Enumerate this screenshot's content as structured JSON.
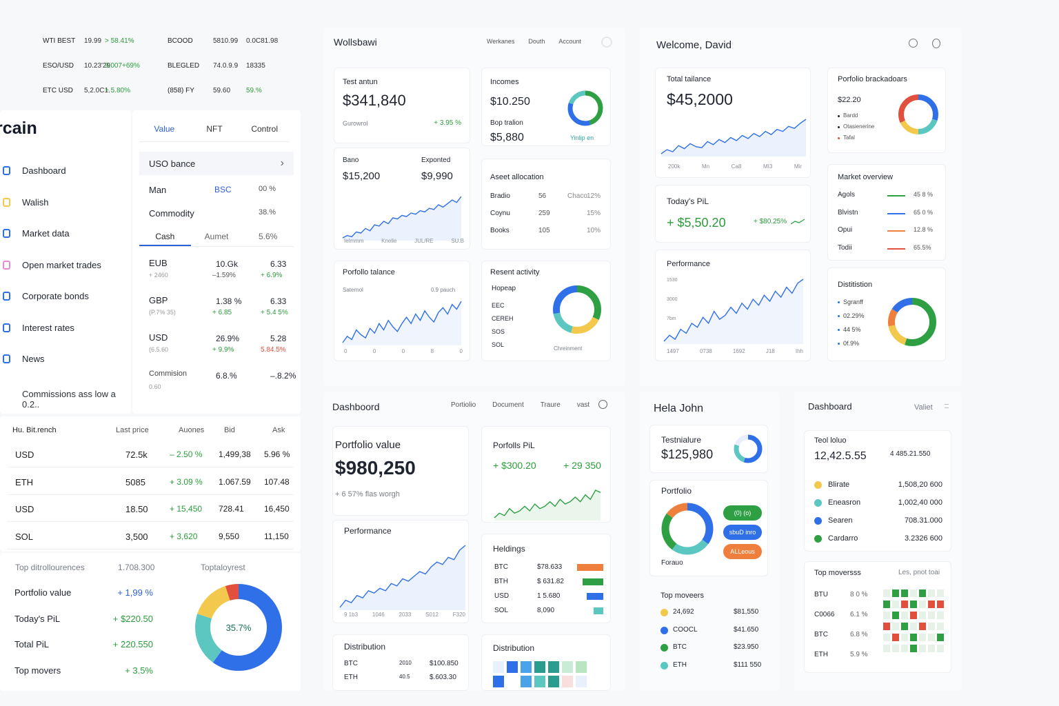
{
  "colors": {
    "blue": "#2f6fe8",
    "green": "#2ea043",
    "yellow": "#f2c94c",
    "teal": "#5cc7c1",
    "orange": "#ef7f3c",
    "red": "#e0503c",
    "light": "#e8eefc"
  },
  "ticker": [
    {
      "a": "WTI BEST",
      "b": "19.99",
      "c": "> 58.41%",
      "d": "BCOOD",
      "e": "5810.99",
      "f": "0.0C81.98"
    },
    {
      "a": "ESO/USD",
      "b": "10.23'29",
      "c": "9.007+69%",
      "d": "BLEGLED",
      "e": "74.0.9.9",
      "f": "18335"
    },
    {
      "a": "ETC USD",
      "b": "5,2.0C1.",
      "c": "+ 5.80%",
      "d": "(858) FY",
      "e": "59.60",
      "f": "59.%"
    }
  ],
  "left": {
    "brand": "rcain",
    "nav": [
      {
        "label": "Dashboard",
        "icon": "document-icon"
      },
      {
        "label": "Walish",
        "icon": "wallet-icon"
      },
      {
        "label": "Market data",
        "icon": "globe-icon"
      },
      {
        "label": "Open market trades",
        "icon": "trade-icon"
      },
      {
        "label": "Corporate bonds",
        "icon": "bar-chart-icon"
      },
      {
        "label": "Interest rates",
        "icon": "monitor-icon"
      },
      {
        "label": "News",
        "icon": "news-icon"
      }
    ],
    "commission": "Commissions ass low a 0.2..",
    "tabs": [
      "Value",
      "NFT",
      "Control"
    ],
    "uso": "USO bance",
    "alloc": [
      {
        "a": "Man",
        "b": "BSC",
        "c": "00 %"
      },
      {
        "a": "Commodity",
        "b": "",
        "c": "38.%"
      }
    ],
    "subtabs": [
      "Cash",
      "Aumet",
      "5.6%"
    ],
    "fx": [
      {
        "cur": "EUB",
        "sub": "+ 2460",
        "v": "10.Gk",
        "v2": "–1.59%",
        "c": "6.33",
        "c2": "+ 6.9%"
      },
      {
        "cur": "GBP",
        "sub": "(P.7% 35)",
        "v": "1.38 %",
        "v2": "+ 6.85",
        "c": "6.33",
        "c2": "+ 5.4 5%"
      },
      {
        "cur": "USD",
        "sub": "(6.5.60",
        "v": "26.9%",
        "v2": "+ 9.9%",
        "c": "5.28",
        "c2": "5.84.5%"
      },
      {
        "cur": "Commision",
        "sub": "0.60",
        "v": "6.8.%",
        "v2": "",
        "c": "–.8.2%",
        "c2": ""
      }
    ],
    "table": {
      "headers": [
        "Hu. Bit.rench",
        "Last price",
        "Auones",
        "Bid",
        "Ask"
      ],
      "rows": [
        [
          "USD",
          "72.5k",
          "– 2.50 %",
          "1,499,38",
          "5.96 %"
        ],
        [
          "ETH",
          "5085",
          "+ 3.09 %",
          "1.067.59",
          "107.48"
        ],
        [
          "USD",
          "18.50",
          "+ 15,450",
          "728.41",
          "16,450"
        ],
        [
          "SOL",
          "3,500",
          "+ 3,620",
          "9,550",
          "11,150"
        ]
      ]
    },
    "summary": {
      "top_label": "Top ditrollourences",
      "top_value": "1.708.300",
      "rows": [
        {
          "l": "Portfolio value",
          "v": "+ 1,99 %"
        },
        {
          "l": "Today's PiL",
          "v": "+ $220.50"
        },
        {
          "l": "Total PiL",
          "v": "+ 220.550"
        },
        {
          "l": "Top movers",
          "v": "+ 3.5%"
        }
      ],
      "donut_title": "Toptaloyrest",
      "donut_center": "35.7%",
      "donut": [
        {
          "v": 0.6,
          "c": "blue"
        },
        {
          "v": 0.2,
          "c": "teal"
        },
        {
          "v": 0.15,
          "c": "yellow"
        },
        {
          "v": 0.05,
          "c": "red"
        }
      ]
    }
  },
  "mid_top": {
    "title": "Wollsbawi",
    "nav": [
      "Werkanes",
      "Douth",
      "Account"
    ],
    "c1": {
      "label": "Test antun",
      "value": "$341,840",
      "sub": "Gurowrol",
      "change": "+ 3.95 %"
    },
    "c2": {
      "label": "Incomes",
      "value": "$10.250",
      "sub": "Bop tralion",
      "value2": "$5,880",
      "caption": "Yinlip en",
      "donut": [
        {
          "v": 0.45,
          "c": "green"
        },
        {
          "v": 0.35,
          "c": "blue"
        },
        {
          "v": 0.2,
          "c": "teal"
        }
      ]
    },
    "c3": {
      "a_label": "Bano",
      "a_val": "$15,200",
      "b_label": "Exponted",
      "b_val": "$9,990",
      "ticks": [
        "Ielmmm",
        "Knelle",
        "JUL/RE",
        "SU.B"
      ],
      "line": [
        5,
        7,
        6,
        10,
        9,
        13,
        11,
        16,
        15,
        19,
        17,
        22,
        21,
        24,
        23,
        26,
        25,
        28,
        27,
        30,
        29,
        33,
        31,
        34,
        37,
        35,
        40
      ]
    },
    "c4": {
      "title": "Aseet allocation",
      "rows": [
        {
          "a": "Bradio",
          "b": "56",
          "c": "Chaco",
          "d": "12%"
        },
        {
          "a": "Coynu",
          "b": "259",
          "c": "",
          "d": "15%"
        },
        {
          "a": "Books",
          "b": "105",
          "c": "",
          "d": "10%"
        }
      ]
    },
    "c5": {
      "title": "Porfollo talance",
      "sub": "Saternol",
      "sub2": "0.9 pauch",
      "ticks": [
        "0",
        "0",
        "0",
        "8",
        "0"
      ],
      "line": [
        10,
        14,
        12,
        18,
        15,
        13,
        19,
        16,
        22,
        18,
        24,
        20,
        17,
        22,
        26,
        22,
        28,
        24,
        30,
        26,
        23,
        29,
        32,
        28,
        34,
        31,
        36
      ]
    },
    "c6": {
      "title": "Resent activity",
      "rows": [
        "Hopeap",
        "EEC",
        "CEREH",
        "SOS",
        "SOL"
      ],
      "caption": "Chreinment",
      "donut": [
        {
          "v": 0.32,
          "c": "green"
        },
        {
          "v": 0.22,
          "c": "yellow"
        },
        {
          "v": 0.18,
          "c": "teal"
        },
        {
          "v": 0.28,
          "c": "blue"
        }
      ]
    }
  },
  "right_top": {
    "title": "Welcome, David",
    "c1": {
      "label": "Total tailance",
      "value": "$45,2000",
      "ticks": [
        "200k",
        "Mn",
        "Ca8",
        "MI3",
        "Mir"
      ],
      "line": [
        8,
        12,
        10,
        16,
        13,
        18,
        15,
        14,
        20,
        17,
        22,
        19,
        24,
        21,
        26,
        23,
        28,
        25,
        30,
        27,
        32,
        30,
        35,
        33,
        38,
        42
      ]
    },
    "c2": {
      "title": "Porfolio brackadoars",
      "value": "$22.20",
      "items": [
        "Bardd",
        "Otasienerine",
        "Tafal"
      ],
      "donut": [
        {
          "v": 0.3,
          "c": "blue"
        },
        {
          "v": 0.2,
          "c": "teal"
        },
        {
          "v": 0.18,
          "c": "yellow"
        },
        {
          "v": 0.32,
          "c": "red"
        }
      ]
    },
    "c3": {
      "label": "Today's PiL",
      "value": "+ $5,50.20",
      "change": "+ $80.25%"
    },
    "c4": {
      "title": "Market overview",
      "rows": [
        {
          "a": "Agols",
          "b": "45 8 %",
          "c": "green"
        },
        {
          "a": "Blvistn",
          "b": "65 0 %",
          "c": "blue"
        },
        {
          "a": "Opui",
          "b": "12.8 %",
          "c": "orange"
        },
        {
          "a": "Todii",
          "b": "65.5%",
          "c": "red"
        }
      ]
    },
    "c5": {
      "title": "Performance",
      "yt": [
        "1530",
        "3000",
        "7bm"
      ],
      "ticks": [
        "1497",
        "0738",
        "1692",
        "J18",
        "Ihh"
      ],
      "line": [
        3,
        6,
        4,
        9,
        7,
        12,
        10,
        15,
        12,
        18,
        14,
        16,
        20,
        17,
        22,
        19,
        24,
        21,
        26,
        23,
        28,
        25,
        30,
        27,
        32,
        34
      ]
    },
    "c6": {
      "title": "Distitistion",
      "items": [
        {
          "l": "Sgranff",
          "c": "blue"
        },
        {
          "l": "02.29%",
          "c": "blue"
        },
        {
          "l": "44 5%",
          "c": "blue"
        },
        {
          "l": "0f.9%",
          "c": "blue"
        }
      ],
      "donut": [
        {
          "v": 0.55,
          "c": "green"
        },
        {
          "v": 0.17,
          "c": "yellow"
        },
        {
          "v": 0.12,
          "c": "orange"
        },
        {
          "v": 0.16,
          "c": "blue"
        }
      ]
    }
  },
  "mid_bot": {
    "title": "Dashboord",
    "nav": [
      "Portiolio",
      "Document",
      "Traure",
      "vast"
    ],
    "c1": {
      "label": "Portfolio value",
      "value": "$980,250",
      "sub": "+ 6 57% flas worgh"
    },
    "c2": {
      "label": "Porfolls PiL",
      "a": "+ $300.20",
      "b": "+ 29 350",
      "line": [
        10,
        12,
        11,
        14,
        12,
        13,
        15,
        13,
        16,
        14,
        15,
        17,
        15,
        18,
        16,
        17,
        19,
        17,
        20,
        18,
        22,
        21
      ]
    },
    "c3": {
      "title": "Performance",
      "ticks": [
        "9 1b3",
        "1046",
        "2033",
        "S012",
        "F320"
      ],
      "line": [
        4,
        7,
        6,
        9,
        8,
        11,
        10,
        12,
        11,
        14,
        13,
        16,
        15,
        17,
        19,
        18,
        21,
        23,
        22,
        25,
        24,
        28,
        30
      ]
    },
    "c4": {
      "title": "Heldings",
      "rows": [
        {
          "a": "BTC",
          "b": "$78.633",
          "c": "orange"
        },
        {
          "a": "BTH",
          "b": "$ 631.82",
          "c": "green"
        },
        {
          "a": "USD",
          "b": "1 5.680",
          "c": "blue"
        },
        {
          "a": "SOL",
          "b": "8,090",
          "c": "teal"
        }
      ]
    },
    "c5": {
      "title": "Distribution",
      "rows": [
        {
          "a": "BTC",
          "b": "2010",
          "c": "$100.850"
        },
        {
          "a": "ETH",
          "b": "40.5",
          "c": "$.603.30"
        }
      ]
    },
    "c6": {
      "title": "Distribution"
    }
  },
  "hela": {
    "title": "Hela  John",
    "c1": {
      "label": "Testnialure",
      "value": "$125,980",
      "donut": [
        {
          "v": 0.55,
          "c": "blue"
        },
        {
          "v": 0.25,
          "c": "teal"
        },
        {
          "v": 0.2,
          "c": "light"
        }
      ]
    },
    "c2": {
      "title": "Portfolio",
      "caption": "Forauo",
      "donut": [
        {
          "v": 0.35,
          "c": "blue"
        },
        {
          "v": 0.25,
          "c": "teal"
        },
        {
          "v": 0.25,
          "c": "green"
        },
        {
          "v": 0.15,
          "c": "orange"
        }
      ],
      "pills": [
        "(0) (o)",
        "sbuD inro",
        "ALLeous"
      ]
    },
    "movers_title": "Top moveers",
    "movers": [
      {
        "a": "24,692",
        "b": "$81,550",
        "c": "yellow"
      },
      {
        "a": "COOCL",
        "b": "$41.650",
        "c": "blue"
      },
      {
        "a": "BTC",
        "b": "$23.950",
        "c": "green"
      },
      {
        "a": "ETH",
        "b": "$111 550",
        "c": "teal"
      }
    ]
  },
  "dash_r": {
    "title": "Dashboard",
    "nav": "Valiet",
    "c1": {
      "label": "Teol loluo",
      "value": "12,42.5.55",
      "side": "4 485.21.550"
    },
    "coins": [
      {
        "a": "Blirate",
        "b": "1,508,20 600",
        "c": "yellow"
      },
      {
        "a": "Eneasron",
        "b": "1,002,40 000",
        "c": "teal"
      },
      {
        "a": "Searen",
        "b": "708.31.000",
        "c": "blue"
      },
      {
        "a": "Cardarro",
        "b": "3.2326 600",
        "c": "green"
      }
    ],
    "movers": {
      "title": "Top moversss",
      "side": "Les, pnot toai",
      "rows": [
        {
          "a": "BTU",
          "b": "8 0 %"
        },
        {
          "a": "C0066",
          "b": "6.1 %"
        },
        {
          "a": "BTC",
          "b": "6.8 %"
        },
        {
          "a": "ETH",
          "b": "5.9 %"
        }
      ]
    }
  }
}
